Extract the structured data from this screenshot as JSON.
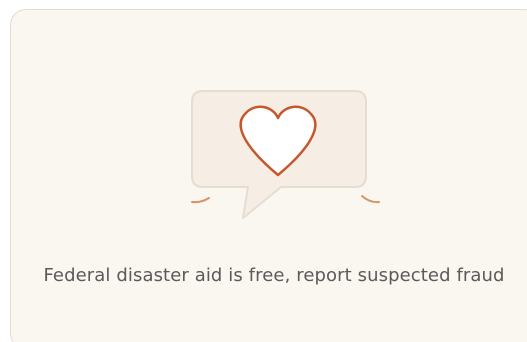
{
  "card": {
    "message": "Federal disaster aid is free, report suspected fraud",
    "illustration_icon": "heart-speech-bubble-icon",
    "colors": {
      "card_background": "#faf6f0",
      "card_border": "#e2ddd4",
      "bubble_fill": "#f6eee5",
      "bubble_stroke": "#e6ddd2",
      "heart_stroke": "#c4582c",
      "accent_dash": "#d9935f",
      "text": "#5a5a5a"
    }
  }
}
